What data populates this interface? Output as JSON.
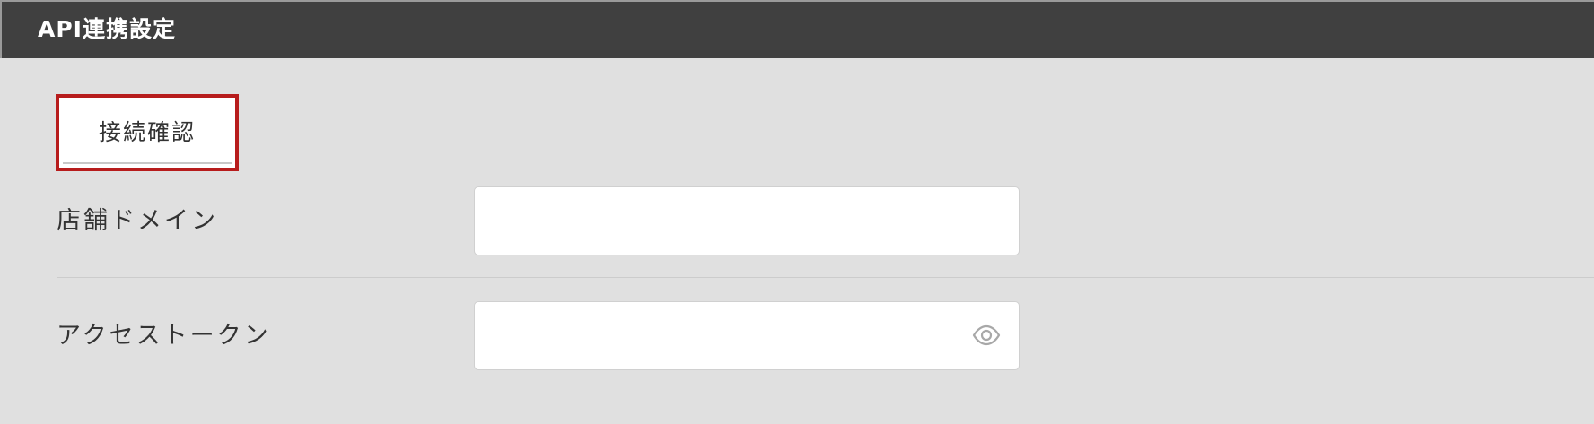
{
  "panel": {
    "title": "API連携設定"
  },
  "actions": {
    "connect_check_label": "接続確認"
  },
  "form": {
    "domain": {
      "label": "店舗ドメイン",
      "value": ""
    },
    "token": {
      "label": "アクセストークン",
      "value": ""
    }
  },
  "icons": {
    "token_visibility": "eye-icon"
  },
  "colors": {
    "header_bg": "#404040",
    "page_bg": "#e0e0e0",
    "highlight_border": "#b71c1c"
  }
}
